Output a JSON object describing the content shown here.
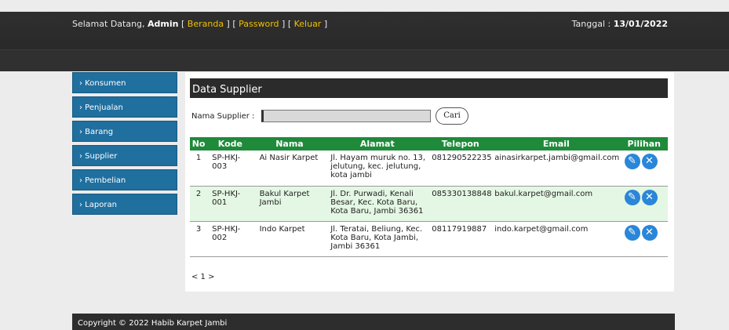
{
  "header": {
    "welcome": "Selamat Datang, ",
    "user": "Admin",
    "link_beranda": "Beranda",
    "link_password": "Password",
    "link_keluar": "Keluar",
    "date_label": "Tanggal : ",
    "date_value": "13/01/2022"
  },
  "sidebar": {
    "items": [
      {
        "label": "› Konsumen"
      },
      {
        "label": "› Penjualan"
      },
      {
        "label": "› Barang"
      },
      {
        "label": "› Supplier"
      },
      {
        "label": "› Pembelian"
      },
      {
        "label": "› Laporan"
      }
    ]
  },
  "main": {
    "title": "Data Supplier",
    "search_label": "Nama Supplier :",
    "search_value": "",
    "search_button": "Cari",
    "table": {
      "headers": [
        "No",
        "Kode",
        "Nama",
        "Alamat",
        "Telepon",
        "Email",
        "Pilihan"
      ],
      "rows": [
        {
          "no": "1",
          "kode": "SP-HKJ-003",
          "nama": "Ai Nasir Karpet",
          "alamat": "Jl. Hayam muruk no. 13, jelutung, kec. jelutung, kota jambi",
          "telepon": "081290522235",
          "email": "ainasirkarpet.jambi@gmail.com"
        },
        {
          "no": "2",
          "kode": "SP-HKJ-001",
          "nama": "Bakul Karpet Jambi",
          "alamat": "Jl. Dr. Purwadi, Kenali Besar, Kec. Kota Baru, Kota Baru, Jambi 36361",
          "telepon": "085330138848",
          "email": "bakul.karpet@gmail.com"
        },
        {
          "no": "3",
          "kode": "SP-HKJ-002",
          "nama": "Indo Karpet",
          "alamat": "Jl. Teratai, Beliung, Kec. Kota Baru, Kota Jambi, Jambi 36361",
          "telepon": "08117919887",
          "email": "indo.karpet@gmail.com"
        }
      ]
    },
    "pager": "< 1 >"
  },
  "icons": {
    "edit": "pencil-icon",
    "delete": "close-icon"
  },
  "colors": {
    "menu": "#1f6f9f",
    "table_header": "#1f8a3a",
    "link": "#f0c000",
    "row_alt": "#e4f7e4"
  },
  "footer": {
    "text": "Copyright © 2022 Habib Karpet Jambi"
  }
}
